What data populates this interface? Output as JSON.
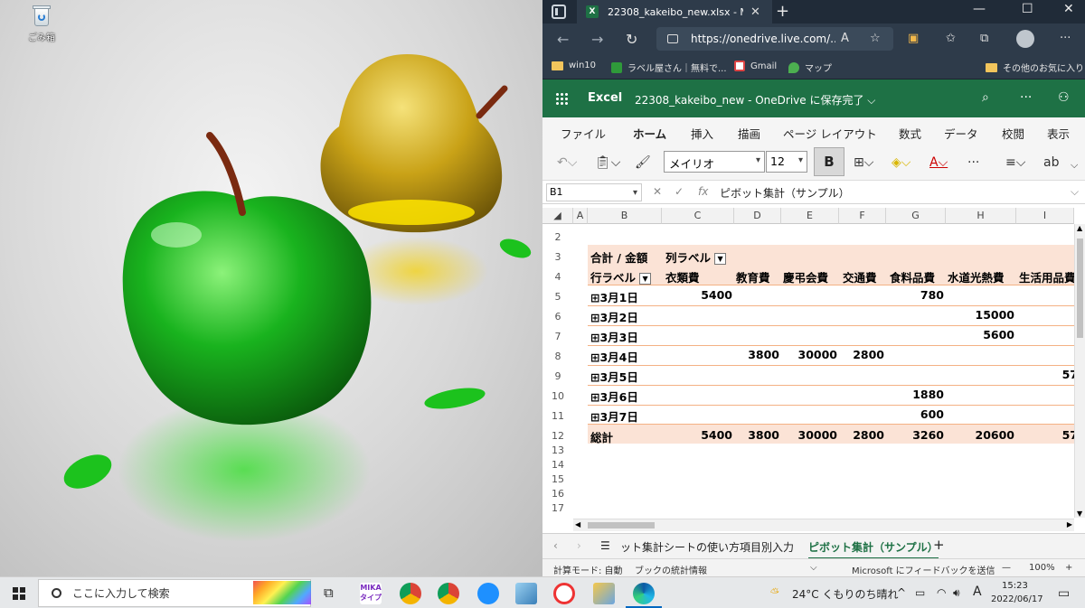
{
  "desktop": {
    "recycle_bin_label": "ごみ箱"
  },
  "browser": {
    "tab_title": "22308_kakeibo_new.xlsx - Microsoft",
    "tab_icon_letter": "X",
    "url": "https://onedrive.live.com/...",
    "favorites": [
      "win10",
      "ラベル屋さん｜無料で...",
      "Gmail",
      "マップ",
      "その他のお気に入り"
    ]
  },
  "excel": {
    "app_name": "Excel",
    "doc_title": "22308_kakeibo_new  -  OneDrive に保存完了 ⌵",
    "ribbon_tabs": [
      "ファイル",
      "ホーム",
      "挿入",
      "描画",
      "ページ レイアウト",
      "数式",
      "データ",
      "校閲",
      "表示"
    ],
    "active_tab": "ホーム",
    "font_name": "メイリオ",
    "font_size": "12",
    "bold_label": "B",
    "name_box": "B1",
    "formula_value": "ピボット集計（サンプル）",
    "columns": [
      "A",
      "B",
      "C",
      "D",
      "E",
      "F",
      "G",
      "H",
      "I"
    ],
    "rows": [
      "2",
      "3",
      "4",
      "5",
      "6",
      "7",
      "8",
      "9",
      "10",
      "11",
      "12",
      "13",
      "14",
      "15",
      "16",
      "17"
    ],
    "pivot": {
      "sum_label": "合計 / 金額",
      "col_label": "列ラベル",
      "row_label": "行ラベル",
      "headers": [
        "衣類費",
        "教育費",
        "慶弔会費",
        "交通費",
        "食料品費",
        "水道光熱費",
        "生活用品費"
      ],
      "data_rows": [
        {
          "label": "⊞3月1日",
          "values": [
            "5400",
            "",
            "",
            "",
            "780",
            "",
            ""
          ]
        },
        {
          "label": "⊞3月2日",
          "values": [
            "",
            "",
            "",
            "",
            "",
            "15000",
            ""
          ]
        },
        {
          "label": "⊞3月3日",
          "values": [
            "",
            "",
            "",
            "",
            "",
            "5600",
            ""
          ]
        },
        {
          "label": "⊞3月4日",
          "values": [
            "",
            "3800",
            "30000",
            "2800",
            "",
            "",
            ""
          ]
        },
        {
          "label": "⊞3月5日",
          "values": [
            "",
            "",
            "",
            "",
            "",
            "",
            "57"
          ]
        },
        {
          "label": "⊞3月6日",
          "values": [
            "",
            "",
            "",
            "",
            "1880",
            "",
            ""
          ]
        },
        {
          "label": "⊞3月7日",
          "values": [
            "",
            "",
            "",
            "",
            "600",
            "",
            ""
          ]
        }
      ],
      "total_label": "総計",
      "totals": [
        "5400",
        "3800",
        "30000",
        "2800",
        "3260",
        "20600",
        "57"
      ]
    },
    "sheet_tabs": [
      "ット集計シートの使い方",
      "項目別入力",
      "ピボット集計（サンプル）"
    ],
    "active_sheet": "ピボット集計（サンプル）",
    "status": {
      "calc_mode": "計算モード: 自動",
      "workbook_stats": "ブックの統計情報",
      "feedback": "Microsoft にフィードバックを送信",
      "zoom": "100%"
    }
  },
  "taskbar": {
    "search_placeholder": "ここに入力して検索",
    "weather": "24°C  くもりのち晴れ",
    "ime": "A",
    "time": "15:23",
    "date": "2022/06/17"
  }
}
